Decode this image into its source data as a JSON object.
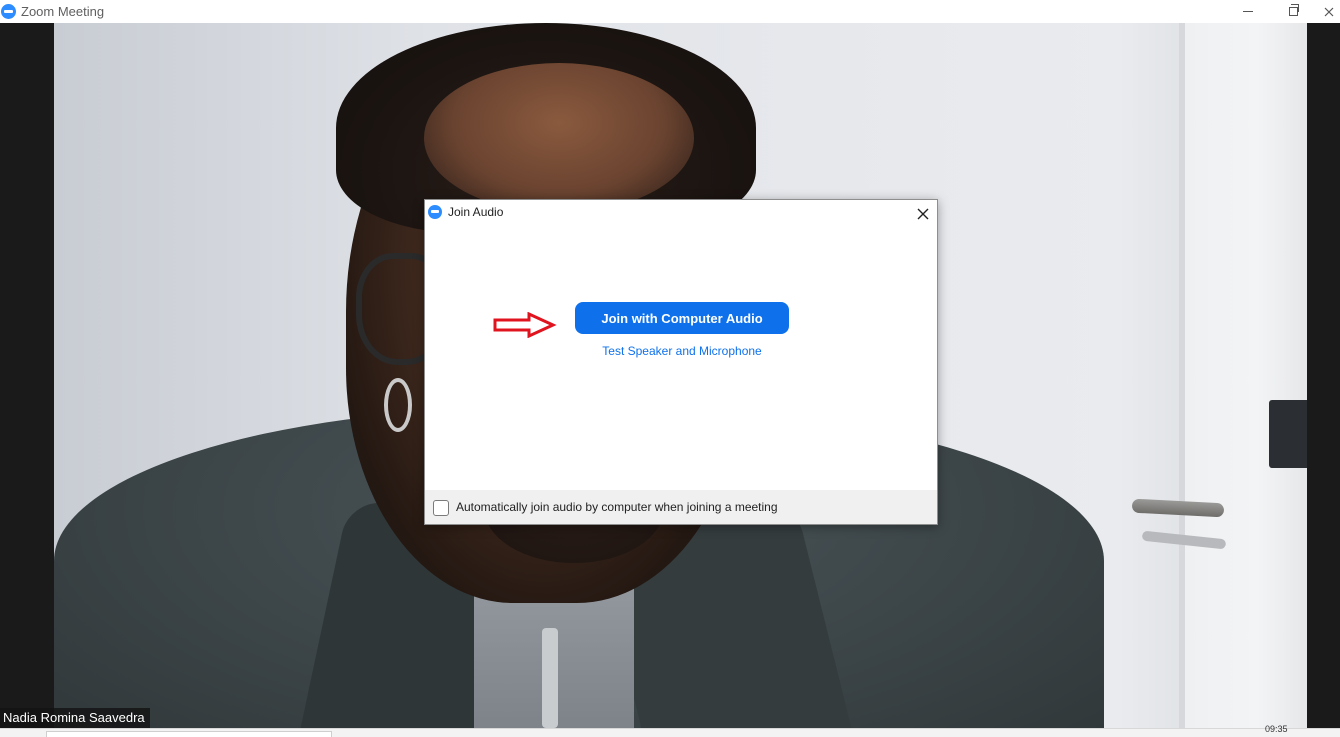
{
  "window": {
    "title": "Zoom Meeting"
  },
  "video": {
    "participant_name": "Nadia Romina Saavedra"
  },
  "dialog": {
    "title": "Join Audio",
    "join_button_label": "Join with Computer Audio",
    "test_link_label": "Test Speaker and Microphone",
    "auto_join_label": "Automatically join audio by computer when joining a meeting",
    "auto_join_checked": false
  },
  "taskbar": {
    "clock": "09:35"
  },
  "colors": {
    "accent": "#0e71eb",
    "zoom_brand": "#2d8cff",
    "arrow": "#e0141e"
  },
  "icons": {
    "app": "zoom-logo-icon",
    "minimize": "minimize-icon",
    "restore": "restore-icon",
    "close": "close-icon",
    "dialog_close": "close-icon",
    "arrow": "right-arrow-icon"
  }
}
